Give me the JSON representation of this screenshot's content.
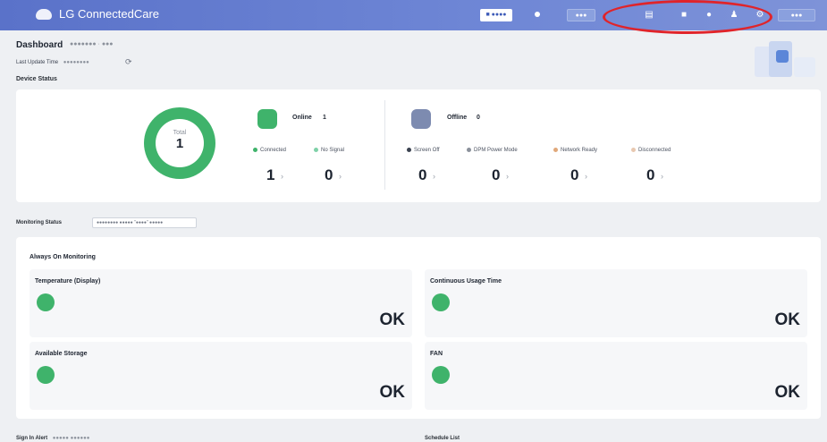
{
  "header": {
    "brand": "LG ConnectedCare",
    "status_pill": "■ ●●●●",
    "button_dim": "●●●",
    "icons": [
      "monitor-icon",
      "folder-icon",
      "bell-icon",
      "user-icon",
      "settings-icon"
    ],
    "right_button": "●●●"
  },
  "page": {
    "title": "Dashboard",
    "breadcrumb": "●●●●●●● · ●●●",
    "last_update_label": "Last Update Time",
    "last_update_value": "●●●●●●●●",
    "device_status_label": "Device Status"
  },
  "device_status": {
    "total_label": "Total",
    "total_value": "1",
    "online": {
      "label": "Online",
      "count": "1"
    },
    "offline": {
      "label": "Offline",
      "count": "0"
    },
    "online_items": [
      {
        "label": "Connected",
        "value": "1",
        "color": "#3fb36b"
      },
      {
        "label": "No Signal",
        "value": "0",
        "color": "#7fd1a8"
      }
    ],
    "offline_items": [
      {
        "label": "Screen Off",
        "value": "0",
        "color": "#3b4250"
      },
      {
        "label": "DPM Power Mode",
        "value": "0",
        "color": "#8b919b"
      },
      {
        "label": "Network Ready",
        "value": "0",
        "color": "#e0a87a"
      },
      {
        "label": "Disconnected",
        "value": "0",
        "color": "#e8c8b0"
      }
    ]
  },
  "monitoring": {
    "section_label": "Monitoring Status",
    "badge_text": "●●●●●●●● ●●●●● \"●●●●\" ●●●●●",
    "card_title": "Always On Monitoring",
    "tiles": [
      {
        "name": "Temperature (Display)",
        "status": "OK"
      },
      {
        "name": "Continuous Usage Time",
        "status": "OK"
      },
      {
        "name": "Available Storage",
        "status": "OK"
      },
      {
        "name": "FAN",
        "status": "OK"
      }
    ]
  },
  "bottom": {
    "left_title": "Sign In Alert",
    "left_sub": "●●●●● ●●●●●●",
    "right_title": "Schedule List"
  },
  "colors": {
    "topbar": "#6f87d6",
    "online_green": "#3fb36b",
    "highlight": "#e0242a"
  }
}
